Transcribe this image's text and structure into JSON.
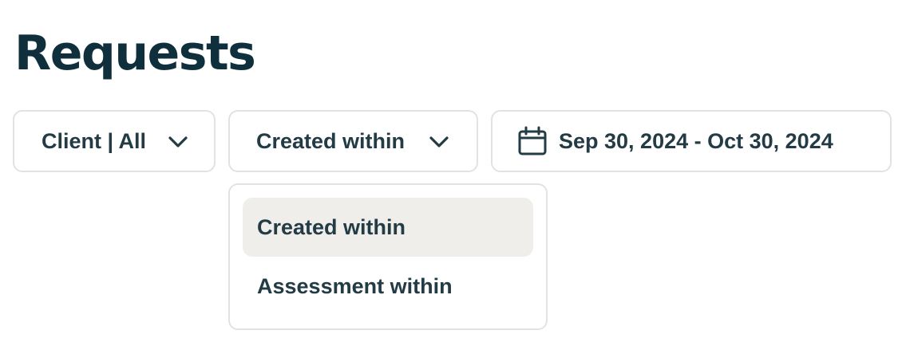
{
  "header": {
    "title": "Requests"
  },
  "filters": {
    "client": {
      "label": "Client | All",
      "icon": "chevron-down-icon"
    },
    "date_type": {
      "label": "Created within",
      "icon": "chevron-down-icon",
      "expanded": true
    },
    "date_range": {
      "label": "Sep 30, 2024 - Oct 30, 2024",
      "icon": "calendar-icon"
    }
  },
  "dropdown": {
    "options": [
      {
        "label": "Created within",
        "highlighted": true
      },
      {
        "label": "Assessment within",
        "highlighted": false
      }
    ]
  },
  "colors": {
    "title": "#0f2f3d",
    "text": "#223b45",
    "border": "#e1e3e2",
    "highlight": "#efeeea"
  }
}
